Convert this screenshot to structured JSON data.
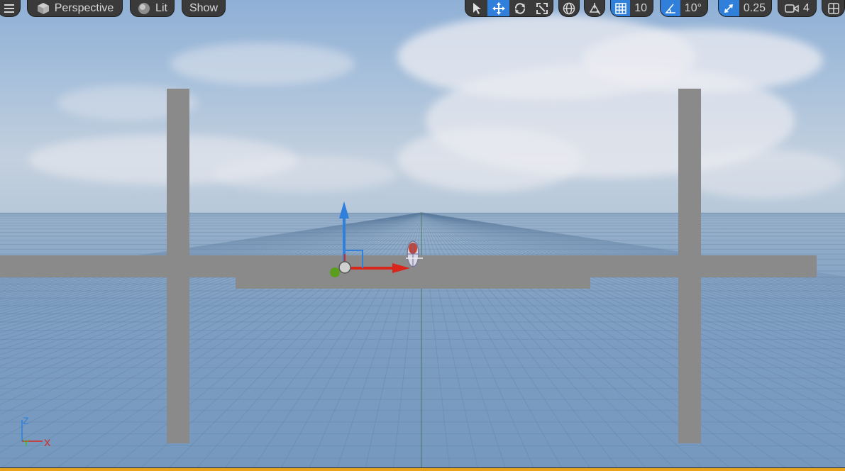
{
  "toolbar": {
    "menu_icon": "hamburger-icon",
    "view_mode": {
      "icon": "cube-icon",
      "label": "Perspective"
    },
    "lighting": {
      "icon": "sphere-icon",
      "label": "Lit"
    },
    "show": {
      "label": "Show"
    },
    "transform_tools": [
      {
        "icon": "select-arrow-icon",
        "active": false
      },
      {
        "icon": "move-icon",
        "active": true
      },
      {
        "icon": "rotate-icon",
        "active": false
      },
      {
        "icon": "scale-icon",
        "active": false
      }
    ],
    "world_local_icon": "globe-icon",
    "surface_snap_icon": "surface-snap-icon",
    "grid_snap": {
      "icon": "grid-icon",
      "value": "10"
    },
    "rotation_snap": {
      "icon": "angle-icon",
      "value": "10°"
    },
    "scale_snap": {
      "icon": "scale-arrow-icon",
      "value": "0.25"
    },
    "camera_speed": {
      "icon": "camera-icon",
      "value": "4"
    },
    "layout_icon": "viewport-layout-icon"
  },
  "axis_indicator": {
    "z": "Z",
    "y": "Y",
    "x": "X"
  },
  "colors": {
    "active_blue": "#2f7fdb",
    "toolbar_bg": "#3a3a3a",
    "gizmo_x": "#d8261b",
    "gizmo_y": "#5a9e1e",
    "gizmo_z": "#2f7fdb",
    "bottom_accent": "#e7a21e"
  }
}
